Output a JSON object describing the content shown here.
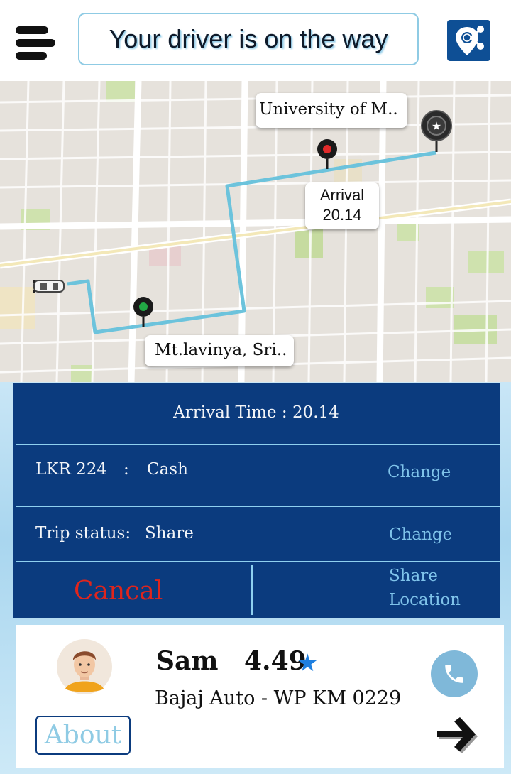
{
  "header": {
    "title": "Your driver is on the way",
    "menu_icon": "hamburger-menu-icon",
    "share_app_icon": "location-share-icon"
  },
  "map": {
    "destination_label": "University of M..",
    "arrival_label": "Arrival",
    "arrival_time": "20.14",
    "origin_label": "Mt.lavinya, Sri..",
    "route_color": "#6cc3dc"
  },
  "trip": {
    "arrival_text": "Arrival Time : 20.14",
    "fare": "LKR 224",
    "separator": ":",
    "payment_method": "Cash",
    "payment_change": "Change",
    "status_label": "Trip status:",
    "status_value": "Share",
    "status_change": "Change",
    "cancel_label": "Cancal",
    "share_location_line1": "Share",
    "share_location_line2": "Location"
  },
  "driver": {
    "name": "Sam",
    "rating": "4.49",
    "star": "★",
    "vehicle": "Bajaj Auto - WP KM 0229",
    "about_label": "About",
    "call_icon": "phone-icon",
    "next_icon": "arrow-right-icon"
  },
  "colors": {
    "panel": "#0b3b7e",
    "accent_link": "#7fc3ea",
    "cancel": "#e0251c",
    "star": "#1e7fe0"
  }
}
